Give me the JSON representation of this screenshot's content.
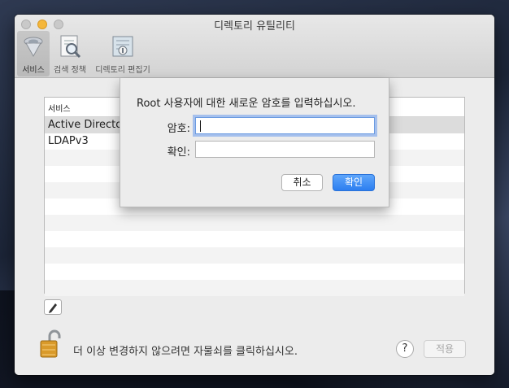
{
  "window": {
    "title": "디렉토리 유틸리티"
  },
  "toolbar": {
    "items": [
      {
        "label": "서비스",
        "icon": "services-icon",
        "selected": true
      },
      {
        "label": "검색 정책",
        "icon": "search-policy-icon",
        "selected": false
      },
      {
        "label": "디렉토리 편집기",
        "icon": "directory-editor-icon",
        "selected": false
      }
    ]
  },
  "services": {
    "header": "서비스",
    "rows": [
      "Active Directory",
      "LDAPv3"
    ]
  },
  "lock_text": "더 이상 변경하지 않으려면 자물쇠를 클릭하십시오.",
  "help_label": "?",
  "apply_label": "적용",
  "dialog": {
    "message": "Root 사용자에 대한 새로운 암호를 입력하십시오.",
    "password_label": "암호:",
    "password_value": "",
    "confirm_label": "확인:",
    "confirm_value": "",
    "cancel_label": "취소",
    "ok_label": "확인"
  },
  "colors": {
    "accent": "#2c7ef0",
    "minimize": "#f5b73b"
  }
}
